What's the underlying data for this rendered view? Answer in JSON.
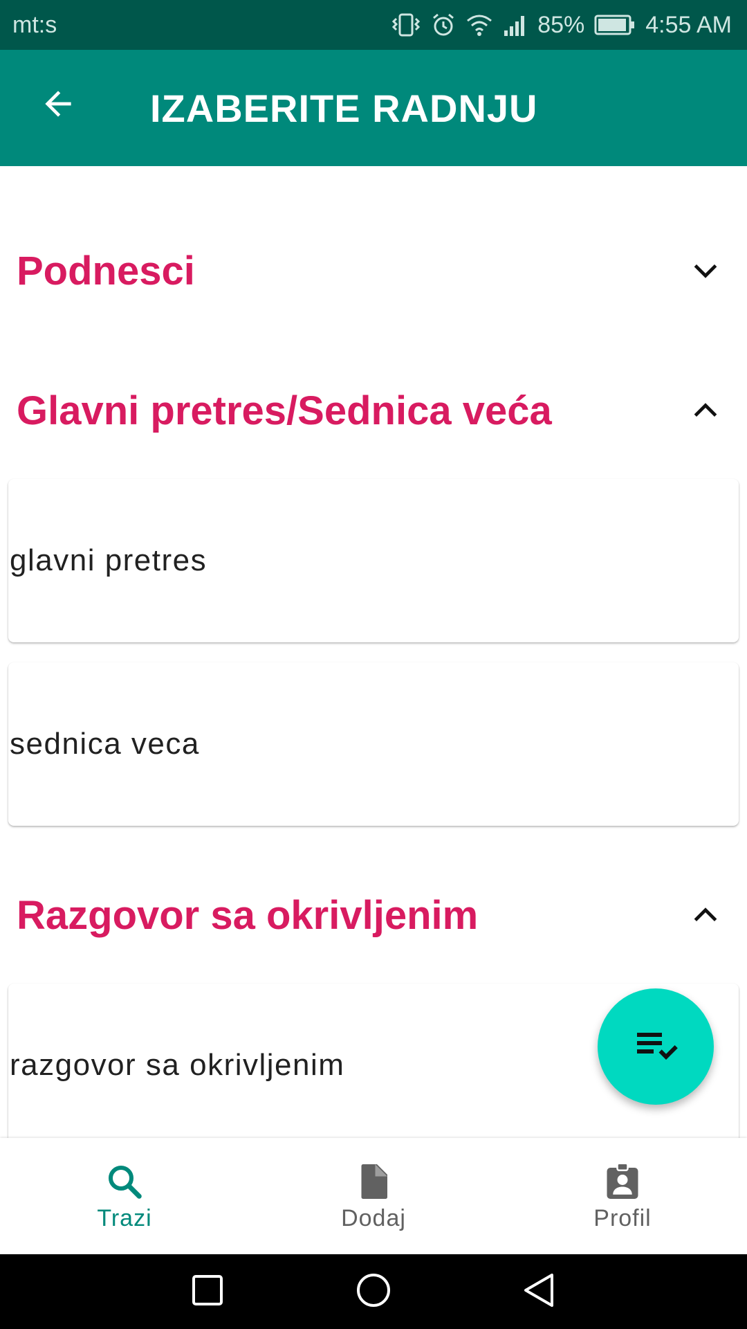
{
  "status_bar": {
    "carrier": "mt:s",
    "battery": "85%",
    "time": "4:55 AM"
  },
  "app_bar": {
    "title": "IZABERITE RADNJU"
  },
  "sections": [
    {
      "title": "Podnesci",
      "expanded": false,
      "items": []
    },
    {
      "title": "Glavni pretres/Sednica veća",
      "expanded": true,
      "items": [
        "glavni pretres",
        "sednica veca"
      ]
    },
    {
      "title": "Razgovor sa okrivljenim",
      "expanded": true,
      "items": [
        "razgovor sa okrivljenim"
      ]
    }
  ],
  "bottom_nav": [
    {
      "label": "Trazi",
      "icon": "search-icon",
      "active": true
    },
    {
      "label": "Dodaj",
      "icon": "document-icon",
      "active": false
    },
    {
      "label": "Profil",
      "icon": "profile-badge-icon",
      "active": false
    }
  ],
  "colors": {
    "status_bar": "#00574B",
    "app_bar": "#00897B",
    "section_title": "#D81B60",
    "fab": "#00D9C0",
    "nav_active": "#00897B"
  }
}
